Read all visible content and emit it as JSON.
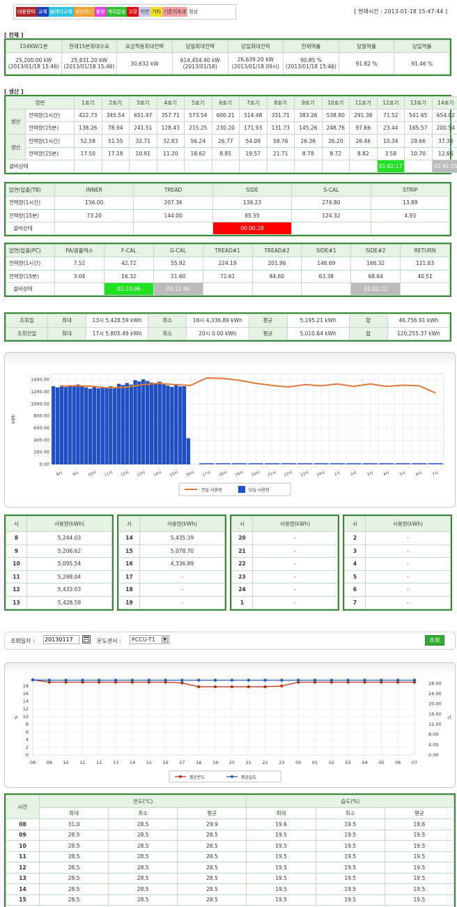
{
  "legend_items": [
    {
      "label": "대용량비",
      "bg": "#b02828",
      "fg": "#fff"
    },
    {
      "label": "교체",
      "bg": "#1e3fbf",
      "fg": "#fff"
    },
    {
      "label": "블레다교체",
      "bg": "#2ec4e0",
      "fg": "#fff"
    },
    {
      "label": "생산대기",
      "bg": "#f0a030",
      "fg": "#fff"
    },
    {
      "label": "불량",
      "bg": "#e040e0",
      "fg": "#fff"
    },
    {
      "label": "계획없음",
      "bg": "#2cc02c",
      "fg": "#fff"
    },
    {
      "label": "고장",
      "bg": "#e01010",
      "fg": "#fff"
    },
    {
      "label": "지연",
      "bg": "#c8c8f0",
      "fg": "#333"
    },
    {
      "label": "기타",
      "bg": "#f0e020",
      "fg": "#333"
    },
    {
      "label": "기준치초과",
      "bg": "#f0a0a0",
      "fg": "#333"
    },
    {
      "label": "정상",
      "bg": "#ffffff",
      "fg": "#333"
    }
  ],
  "current_time": "[ 현재시간 : 2013-01-18 15:47:44 ]",
  "total": {
    "title": "[ 전체 ]",
    "headers": [
      "154KW/1분",
      "현재15분최대수요",
      "요금적용최대전력",
      "당월최대전력",
      "당일최대전력",
      "현재역률",
      "당월역률",
      "당일역률"
    ],
    "values": [
      "25,200.00 kW\n(2013/01/18 15:46)",
      "25,631.20 kW\n(2013/01/18 15:46)",
      "30,632 kW",
      "614,454.40 kW\n(2013/01/16)",
      "26,639.20 kW\n(2013/01/18 09시)",
      "90.85 %\n(2013/01/18 15:46)",
      "91.82 %",
      "91.46 %"
    ]
  },
  "production": {
    "title": "[ 생산 ]",
    "line_header": "정련",
    "units": [
      "1호기",
      "2호기",
      "3호기",
      "4호기",
      "5호기",
      "6호기",
      "7호기",
      "8호기",
      "9호기",
      "10호기",
      "11호기",
      "12호기",
      "13호기",
      "14호기"
    ],
    "group_label": "생산",
    "rows": [
      {
        "label": "전력량(1시간)",
        "values": [
          "422.73",
          "345.54",
          "651.47",
          "357.71",
          "573.54",
          "600.21",
          "514.48",
          "331.71",
          "383.26",
          "538.80",
          "291.38",
          "71.52",
          "541.65",
          "654.02"
        ]
      },
      {
        "label": "전력량(15분)",
        "values": [
          "138.26",
          "78.94",
          "241.51",
          "128.43",
          "215.25",
          "230.20",
          "171.93",
          "131.73",
          "145.26",
          "248.76",
          "97.66",
          "23.44",
          "165.57",
          "200.54"
        ]
      },
      {
        "label": "전력량(1시간)",
        "values": [
          "52.58",
          "51.55",
          "32.71",
          "32.83",
          "56.24",
          "26.77",
          "54.09",
          "58.76",
          "26.36",
          "26.20",
          "26.46",
          "10.34",
          "29.66",
          "37.38"
        ]
      },
      {
        "label": "전력량(15분)",
        "values": [
          "17.50",
          "17.18",
          "10.91",
          "11.20",
          "18.62",
          "8.85",
          "19.57",
          "21.71",
          "8.78",
          "8.72",
          "8.82",
          "3.58",
          "10.70",
          "12.66"
        ]
      }
    ],
    "status_label": "설비상태",
    "status": [
      "",
      "",
      "",
      "",
      "",
      "",
      "",
      "",
      "",
      "",
      "",
      "01:02:17",
      "",
      "01:41:55"
    ],
    "status_colors": [
      "",
      "",
      "",
      "",
      "",
      "",
      "",
      "",
      "",
      "",
      "",
      "green",
      "",
      "gray"
    ]
  },
  "tb": {
    "header": "압연/압출(TB)",
    "cols": [
      "INNER",
      "TREAD",
      "SIDE",
      "S-CAL",
      "STRIP"
    ],
    "rows": [
      {
        "label": "전력량(1시간)",
        "values": [
          "156.00",
          "207.36",
          "139.23",
          "274.80",
          "13.89"
        ]
      },
      {
        "label": "전력량(15분)",
        "values": [
          "73.20",
          "144.00",
          "85.55",
          "124.32",
          "4.93"
        ]
      }
    ],
    "status_label": "설비상태",
    "status": [
      "",
      "",
      "00:00:28",
      "",
      ""
    ],
    "status_colors": [
      "",
      "",
      "red",
      "",
      ""
    ]
  },
  "pc": {
    "header": "압연/압출(PC)",
    "cols": [
      "PA/콤플렉스",
      "F-CAL",
      "G-CAL",
      "TREAD#1",
      "TREAD#2",
      "SIDE#1",
      "SIDE#2",
      "RETURN"
    ],
    "rows": [
      {
        "label": "전력량(1시간)",
        "values": [
          "7.52",
          "42.72",
          "55.92",
          "224.19",
          "201.96",
          "146.69",
          "166.32",
          "121.63"
        ]
      },
      {
        "label": "전력량(15분)",
        "values": [
          "3.04",
          "16.32",
          "21.60",
          "72.61",
          "84.60",
          "63.38",
          "68.64",
          "40.51"
        ]
      }
    ],
    "status_label": "설비상태",
    "status": [
      "",
      "01:33:06",
      "03:12:40",
      "",
      "",
      "",
      "02:02:12",
      ""
    ],
    "status_colors": [
      "",
      "green",
      "gray",
      "",
      "",
      "",
      "gray",
      ""
    ]
  },
  "summary": {
    "rows": [
      {
        "label": "조회일",
        "max_label": "최대",
        "max": "13시 5,428.59 kWh",
        "min_label": "최소",
        "min": "16시 4,336.89 kWh",
        "avg_label": "평균",
        "avg": "5,195.21 kWh",
        "sum_label": "합",
        "sum": "46,756.91 kWh"
      },
      {
        "label": "조회전일",
        "max_label": "최대",
        "max": "17시 5,805.49 kWh",
        "min_label": "최소",
        "min": "20시 0.00 kWh",
        "avg_label": "평균",
        "avg": "5,010.64 kWh",
        "sum_label": "합",
        "sum": "120,255.37 kWh"
      }
    ]
  },
  "chart_data": [
    {
      "type": "bar",
      "y_ticks": [
        "1400.00",
        "1200.00",
        "1000.00",
        "800.00",
        "600.00",
        "400.00",
        "200.00",
        "0.00"
      ],
      "ylim": [
        0,
        1500
      ],
      "ylabel": "kWh",
      "x_labels": [
        "8시",
        "9시",
        "10시",
        "11시",
        "12시",
        "13시",
        "14시",
        "15시",
        "16시",
        "17시",
        "18시",
        "19시",
        "20시",
        "21시",
        "22시",
        "23시",
        "24시",
        "1시",
        "2시",
        "3시",
        "4시",
        "5시",
        "6시",
        "7시"
      ],
      "series": [
        {
          "name": "전일 사용량",
          "kind": "line",
          "color": "#e07838",
          "values": [
            1295,
            1300,
            1290,
            1265,
            1275,
            1315,
            1340,
            1320,
            1305,
            1430,
            1420,
            1390,
            1340,
            1305,
            1280,
            1320,
            1300,
            1330,
            1290,
            1330,
            1290,
            1310,
            1300,
            1180
          ]
        },
        {
          "name": "당일 사용량",
          "kind": "bar",
          "color": "#1f50c8",
          "values": [
            1290,
            1305,
            1270,
            1275,
            1330,
            1390,
            1350,
            1300,
            430,
            0,
            0,
            0,
            0,
            0,
            0,
            0,
            0,
            0,
            0,
            0,
            0,
            0,
            0,
            0
          ]
        }
      ]
    },
    {
      "type": "line",
      "y_ticks": [
        "18",
        "16",
        "14",
        "12",
        "10",
        "8",
        "6",
        "4",
        "2",
        "0"
      ],
      "ylim": [
        0,
        20
      ],
      "ylabel": "%",
      "y2_ticks": [
        "28.00",
        "24.00",
        "20.00",
        "16.00",
        "12.00",
        "8.00",
        "4.00",
        "0.00"
      ],
      "y2lim": [
        0,
        30
      ],
      "y2label": "℃",
      "x_labels": [
        "08",
        "09",
        "10",
        "11",
        "12",
        "13",
        "14",
        "15",
        "16",
        "17",
        "18",
        "19",
        "20",
        "21",
        "22",
        "23",
        "00",
        "01",
        "02",
        "03",
        "04",
        "05",
        "06",
        "07"
      ],
      "series": [
        {
          "name": "평균온도",
          "color": "#c03010",
          "values": [
            19.6,
            19.0,
            19.0,
            19.0,
            19.0,
            19.0,
            19.0,
            19.0,
            19.0,
            18.8,
            17.8,
            17.8,
            17.8,
            17.8,
            17.8,
            18.0,
            19.0,
            19.0,
            19.0,
            19.0,
            19.0,
            19.0,
            19.0,
            19.0
          ]
        },
        {
          "name": "평균습도",
          "color": "#2060c0",
          "values": [
            19.6,
            19.5,
            19.5,
            19.5,
            19.5,
            19.5,
            19.5,
            19.5,
            19.5,
            19.5,
            19.5,
            19.5,
            19.5,
            19.5,
            19.5,
            19.5,
            19.5,
            19.5,
            19.5,
            19.5,
            19.5,
            19.5,
            19.5,
            19.5
          ]
        }
      ]
    }
  ],
  "chart1_legend": [
    "전일 사용량",
    "당일 사용량"
  ],
  "hourly": {
    "col_hour": "시",
    "col_usage": "사용량(kWh)",
    "groups": [
      [
        [
          "8",
          "5,244.03"
        ],
        [
          "9",
          "5,206.62"
        ],
        [
          "10",
          "5,095.54"
        ],
        [
          "11",
          "5,298.04"
        ],
        [
          "12",
          "5,433.03"
        ],
        [
          "13",
          "5,428.59"
        ]
      ],
      [
        [
          "14",
          "5,435.39"
        ],
        [
          "15",
          "5,078.70"
        ],
        [
          "16",
          "4,336.89"
        ],
        [
          "17",
          "-"
        ],
        [
          "18",
          "-"
        ],
        [
          "19",
          "-"
        ]
      ],
      [
        [
          "20",
          "-"
        ],
        [
          "21",
          "-"
        ],
        [
          "22",
          "-"
        ],
        [
          "23",
          "-"
        ],
        [
          "24",
          "-"
        ],
        [
          "1",
          "-"
        ]
      ],
      [
        [
          "2",
          "-"
        ],
        [
          "3",
          "-"
        ],
        [
          "4",
          "-"
        ],
        [
          "5",
          "-"
        ],
        [
          "6",
          "-"
        ],
        [
          "7",
          "-"
        ]
      ]
    ]
  },
  "query": {
    "date_label": "조회일자 :",
    "date_value": "20130117",
    "sensor_label": "온도센서 :",
    "sensor_value": "PCCU-T1",
    "button": "조회"
  },
  "chart2_legend": [
    "평균온도",
    "평균습도"
  ],
  "temp_table": {
    "col_time": "시간",
    "group_temp": "온도(℃)",
    "group_hum": "습도(%)",
    "sub": [
      "최대",
      "최소",
      "평균",
      "최대",
      "최소",
      "평균"
    ],
    "rows": [
      [
        "08",
        "31.0",
        "28.5",
        "29.9",
        "19.6",
        "19.5",
        "19.6"
      ],
      [
        "09",
        "28.5",
        "28.5",
        "28.5",
        "19.5",
        "19.5",
        "19.5"
      ],
      [
        "10",
        "28.5",
        "28.5",
        "28.5",
        "19.5",
        "19.5",
        "19.5"
      ],
      [
        "11",
        "28.5",
        "28.5",
        "28.5",
        "19.5",
        "19.5",
        "19.5"
      ],
      [
        "12",
        "28.5",
        "28.5",
        "28.5",
        "19.5",
        "19.5",
        "19.5"
      ],
      [
        "13",
        "28.5",
        "28.5",
        "28.5",
        "19.5",
        "19.5",
        "19.5"
      ],
      [
        "14",
        "28.5",
        "28.5",
        "28.5",
        "19.5",
        "19.5",
        "19.5"
      ],
      [
        "15",
        "28.5",
        "28.5",
        "28.5",
        "19.5",
        "19.5",
        "19.5"
      ]
    ]
  }
}
